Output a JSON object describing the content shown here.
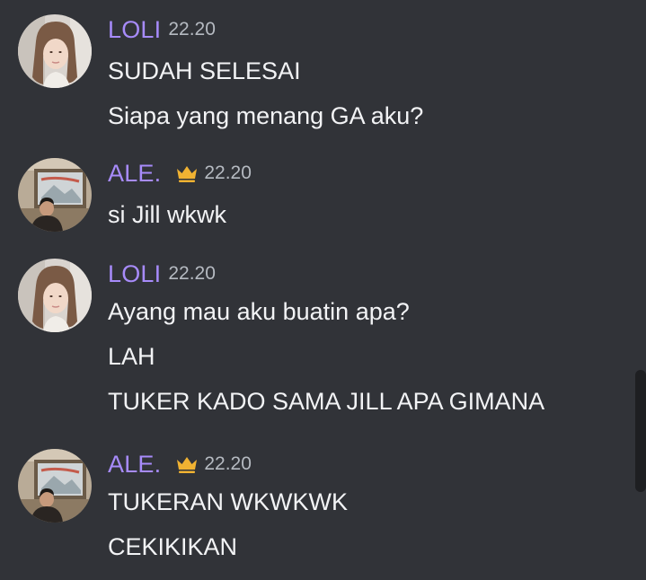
{
  "messages": [
    {
      "user": "LOLI",
      "avatar": "woman-selfie-avatar",
      "crown": false,
      "time": "22.20",
      "lines": [
        "SUDAH SELESAI",
        "Siapa yang menang GA aku?"
      ]
    },
    {
      "user": "ALE.",
      "avatar": "man-room-avatar",
      "crown": true,
      "time": "22.20",
      "lines": [
        "si Jill wkwk"
      ]
    },
    {
      "user": "LOLI",
      "avatar": "woman-selfie-avatar",
      "crown": false,
      "time": "22.20",
      "lines": [
        "Ayang mau aku buatin apa?",
        "LAH",
        "TUKER KADO SAMA JILL APA GIMANA"
      ]
    },
    {
      "user": "ALE.",
      "avatar": "man-room-avatar",
      "crown": true,
      "time": "22.20",
      "lines": [
        "TUKERAN WKWKWK",
        "CEKIKIKAN"
      ]
    }
  ],
  "colors": {
    "background": "#313338",
    "username": "#a78bfa",
    "timestamp": "#b5bac1",
    "text": "#f2f3f5",
    "crown": "#f0b232"
  }
}
